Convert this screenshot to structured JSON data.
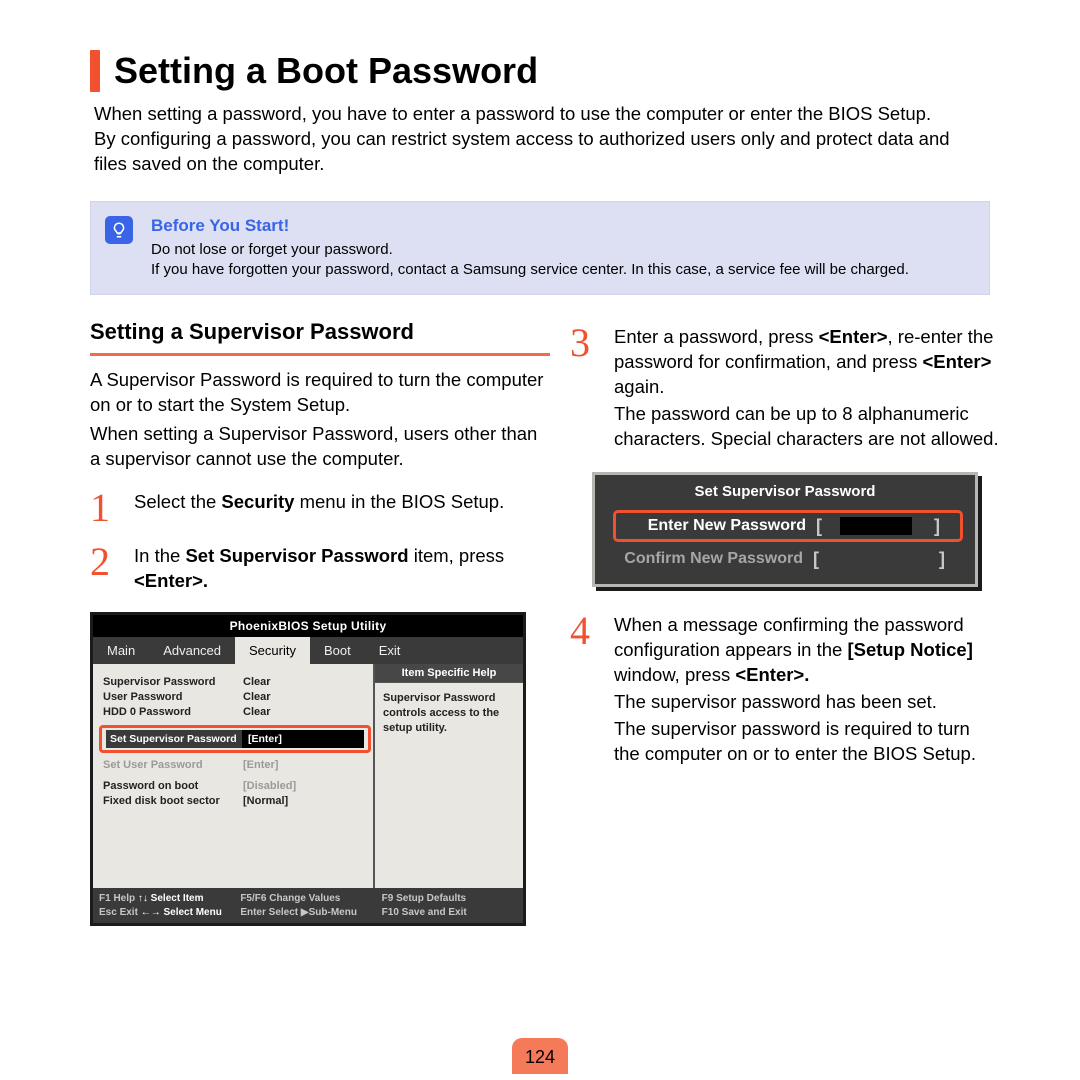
{
  "title": "Setting a Boot Password",
  "intro": "When setting a password, you have to enter a password to use the computer or enter the BIOS Setup.\nBy configuring a password, you can restrict system access to authorized users only and protect data and files saved on the computer.",
  "info": {
    "heading": "Before You Start!",
    "line1": "Do not lose or forget your password.",
    "line2": "If you have forgotten your password, contact a Samsung service center. In this case, a service fee will be charged."
  },
  "left": {
    "subheading": "Setting a Supervisor Password",
    "desc1": "A Supervisor Password is required to turn the computer on or to start the System Setup.",
    "desc2": "When setting a Supervisor Password, users other than a supervisor cannot use the computer.",
    "step1_num": "1",
    "step1_pre": "Select the ",
    "step1_bold": "Security",
    "step1_post": " menu in the BIOS Setup.",
    "step2_num": "2",
    "step2_pre": "In the ",
    "step2_bold": "Set Supervisor Password",
    "step2_mid": " item, press ",
    "step2_key": "<Enter>."
  },
  "bios1": {
    "title": "PhoenixBIOS Setup Utility",
    "tabs": [
      "Main",
      "Advanced",
      "Security",
      "Boot",
      "Exit"
    ],
    "items": [
      {
        "label": "Supervisor Password",
        "value": "Clear"
      },
      {
        "label": "User Password",
        "value": "Clear"
      },
      {
        "label": "HDD 0 Password",
        "value": "Clear"
      }
    ],
    "hl_label": "Set Supervisor Password",
    "hl_value": "[Enter]",
    "after": [
      {
        "label": "Set User Password",
        "value": "[Enter]",
        "grey": true
      },
      {
        "label": "Password on boot",
        "value": "[Disabled]",
        "grey": true
      },
      {
        "label": "Fixed disk boot sector",
        "value": "[Normal]",
        "grey": false
      }
    ],
    "help_title": "Item Specific Help",
    "help_body": "Supervisor Password controls access to the setup utility.",
    "footer": {
      "c1a": "F1    Help",
      "c1b": "↑↓   Select Item",
      "c2a": "Esc   Exit",
      "c2b": "←→  Select Menu",
      "c3a": "F5/F6 Change Values",
      "c3b": "Enter  Select ▶Sub-Menu",
      "c4a": "F9     Setup Defaults",
      "c4b": "F10   Save and Exit"
    }
  },
  "right": {
    "step3_num": "3",
    "step3_a": "Enter a password, press ",
    "step3_b": "<Enter>",
    "step3_c": ", re-enter the password for confirmation, and press ",
    "step3_d": "<Enter>",
    "step3_e": " again.",
    "step3_f": "The password can be up to 8 alphanumeric characters. Special characters are not allowed.",
    "dialog": {
      "title": "Set Supervisor Password",
      "enter": "Enter New Password",
      "confirm": "Confirm New Password"
    },
    "step4_num": "4",
    "step4_a": "When a message confirming the password configuration appears in the ",
    "step4_b": "[Setup Notice]",
    "step4_c": " window, press ",
    "step4_d": "<Enter>.",
    "step4_e": "The supervisor password has been set.",
    "step4_f": "The supervisor password is required to turn the computer on or to enter the BIOS Setup."
  },
  "page_number": "124"
}
